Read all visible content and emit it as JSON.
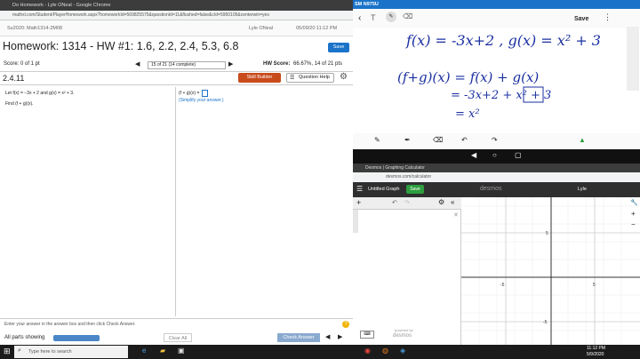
{
  "left_window": {
    "title": "Do Homework - Lyle ONeal - Google Chrome",
    "url": "mathxl.com/Student/PlayerHomework.aspx?homeworkId=569825575&questionId=11&flushed=false&cId=5950105&centerwin=yes",
    "course": "Su2020: Math1314-2M08",
    "user": "Lyle ONeal",
    "datetime": "05/09/20 11:12 PM",
    "hw_title": "Homework: 1314 - HW #1: 1.6, 2.2, 2.4, 5.3, 6.8",
    "save": "Save",
    "score": "Score: 0 of 1 pt",
    "question_nav": "15 of 21 (14 complete)",
    "hw_score_label": "HW Score:",
    "hw_score_value": "66.67%, 14 of 21 pts",
    "question_id": "2.4.11",
    "skill_builder": "Skill Builder",
    "question_help": "Question Help",
    "problem_line1": "Let f(x) = −3x + 2 and g(x) = x² + 3.",
    "problem_line2": "Find (f + g)(x).",
    "answer_prefix": "(f + g)(x) =",
    "answer_hint": "(Simplify your answer.)",
    "instruction": "Enter your answer in the answer box and then click Check Answer.",
    "parts_showing": "All parts showing",
    "clear_all": "Clear All",
    "check_answer": "Check Answer"
  },
  "note_app": {
    "device": "SM N975U",
    "save": "Save",
    "line1": "f(x) = -3x+2 , g(x) = x² + 3",
    "line2": "(f+g)(x) = f(x) + g(x)",
    "line3": "= -3x+2 + x² + 3",
    "line4": "= x²"
  },
  "desmos": {
    "tab": "Desmos | Graphing Calculator",
    "url": "desmos.com/calculator",
    "graph_title": "Untitled Graph",
    "save": "Save",
    "brand": "desmos",
    "user": "Lyle",
    "powered_by": "powered by",
    "powered_brand": "desmos",
    "axis_labels": {
      "x_neg": "-5",
      "x_pos": "5",
      "y_pos": "5",
      "y_neg": "-5"
    }
  },
  "taskbar": {
    "search": "Type here to search",
    "time": "11:12 PM",
    "date": "5/9/2020"
  },
  "colors": {
    "save_blue": "#1a73c9",
    "skill_orange": "#c84b1c",
    "desmos_green": "#2e9e3e",
    "ink_blue": "#1a2fa0"
  }
}
